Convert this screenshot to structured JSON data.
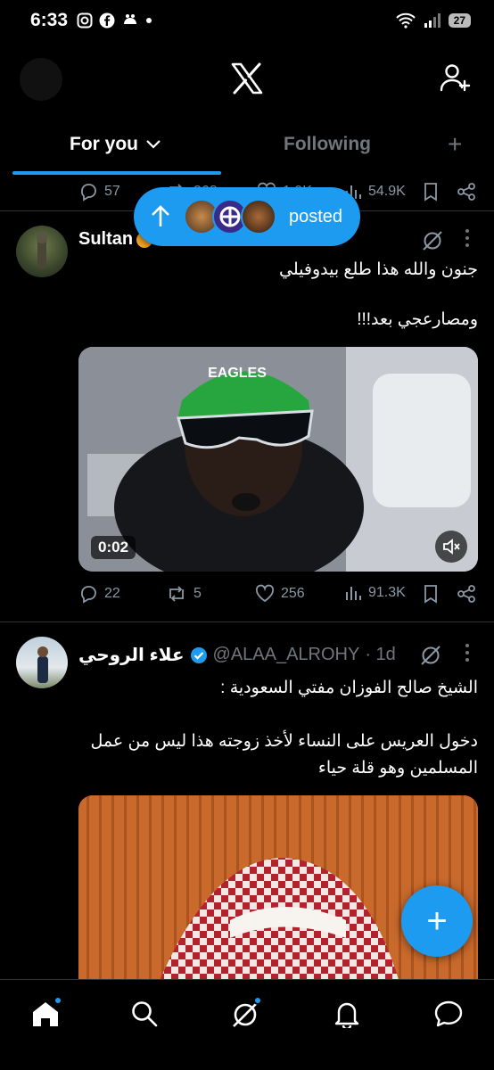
{
  "status_bar": {
    "time": "6:33",
    "battery": "27"
  },
  "header": {
    "logo": "X"
  },
  "tabs": {
    "for_you": "For you",
    "following": "Following",
    "add": "+"
  },
  "prev_tweet": {
    "replies": "57",
    "reposts": "368",
    "likes": "1.9K",
    "views": "54.9K"
  },
  "new_posts_pill": {
    "label": "posted"
  },
  "tweet1": {
    "name": "Sultan",
    "text_line1": "جنون والله هذا طلع بيدوفيلي",
    "text_line2": "ومصارعجي بعد!!!",
    "video_time": "0:02",
    "cap_text": "EAGLES",
    "replies": "22",
    "reposts": "5",
    "likes": "256",
    "views": "91.3K"
  },
  "tweet2": {
    "name": "علاء الروحي",
    "handle": "@ALAA_ALROHY",
    "time": "· 1d",
    "text_line1": "الشيخ صالح الفوزان مفتي السعودية :",
    "text_line2": "دخول العريس على النساء لأخذ زوجته هذا ليس من عمل",
    "text_line3": "المسلمين وهو قلة حياء"
  },
  "fab": {
    "label": "+"
  },
  "colors": {
    "accent": "#1d9bf0",
    "background": "#000000",
    "muted": "#71767b"
  }
}
